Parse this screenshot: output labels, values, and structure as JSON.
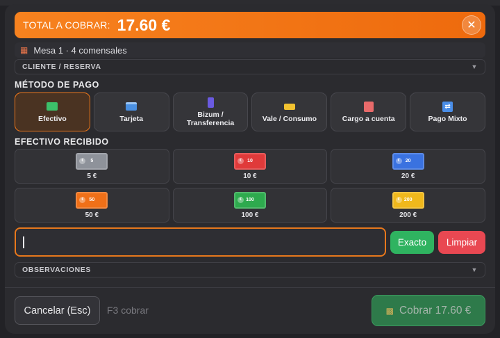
{
  "header": {
    "total_label": "TOTAL A COBRAR:",
    "total_amount": "17.60 €",
    "close_icon": "close-icon"
  },
  "table_info": {
    "icon": "chair-icon",
    "text": "Mesa 1 · 4 comensales"
  },
  "client_section": {
    "label": "CLIENTE / RESERVA",
    "arrow": "▼"
  },
  "payment_method": {
    "title": "MÉTODO DE PAGO",
    "selected": "Efectivo",
    "options": [
      {
        "label": "Efectivo",
        "icon": "cash-icon",
        "color": "#3cc06a"
      },
      {
        "label": "Tarjeta",
        "icon": "credit-card-icon",
        "color": "#4a90e2"
      },
      {
        "label": "Bizum / Transferencia",
        "icon": "phone-icon",
        "color": "#6a5ae0"
      },
      {
        "label": "Vale / Consumo",
        "icon": "ticket-icon",
        "color": "#f2c230"
      },
      {
        "label": "Cargo a cuenta",
        "icon": "hotel-icon",
        "color": "#e86a6a"
      },
      {
        "label": "Pago Mixto",
        "icon": "shuffle-icon",
        "color": "#4a8ee8"
      }
    ]
  },
  "cash_received": {
    "title": "EFECTIVO RECIBIDO",
    "bills": [
      {
        "face": "5",
        "label": "5 €",
        "color": "#8e929a"
      },
      {
        "face": "10",
        "label": "10 €",
        "color": "#e03a3a"
      },
      {
        "face": "20",
        "label": "20 €",
        "color": "#3a72e0"
      },
      {
        "face": "50",
        "label": "50 €",
        "color": "#f07018"
      },
      {
        "face": "100",
        "label": "100 €",
        "color": "#2eaa4e"
      },
      {
        "face": "200",
        "label": "200 €",
        "color": "#f0b81c"
      }
    ],
    "input_value": "",
    "exact_label": "Exacto",
    "clear_label": "Limpiar"
  },
  "observations": {
    "label": "OBSERVACIONES",
    "arrow": "▼"
  },
  "footer": {
    "cancel_label": "Cancelar (Esc)",
    "hint": "F3 cobrar",
    "charge_label": "Cobrar 17.60 €",
    "charge_icon": "cash-stack-icon"
  },
  "colors": {
    "accent": "#f0781a",
    "exact": "#2fb360",
    "clear": "#e94852",
    "charge": "#2e7a4a"
  }
}
